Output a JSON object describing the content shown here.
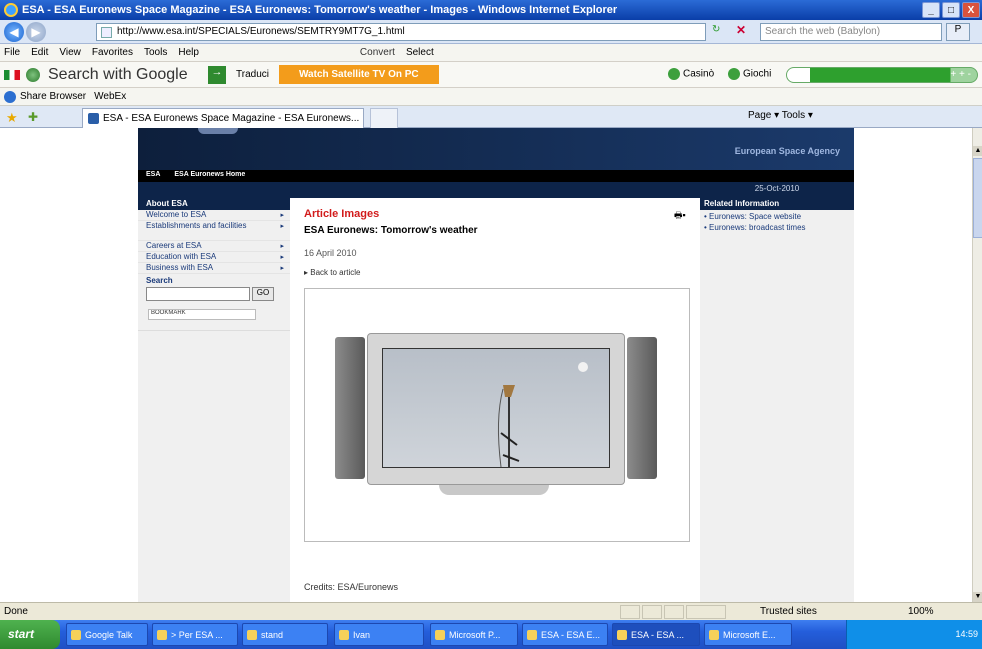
{
  "window": {
    "title": "ESA - ESA Euronews Space Magazine - ESA Euronews: Tomorrow's weather - Images - Windows Internet Explorer",
    "buttons": [
      "_",
      "□",
      "X"
    ]
  },
  "address_bar": {
    "url": "http://www.esa.int/SPECIALS/Euronews/SEMTRY9MT7G_1.html",
    "search_placeholder": "Search the web (Babylon)",
    "search_btn": "P"
  },
  "menu": {
    "items": [
      "File",
      "Edit",
      "View",
      "Favorites",
      "Tools",
      "Help"
    ],
    "convert": "Convert",
    "select": "Select"
  },
  "google_toolbar": {
    "search_placeholder": "Search with Google",
    "go": "→",
    "traduci": "Traduci",
    "watch": "Watch Satellite TV On PC",
    "casino": "Casinò",
    "giochi": "Giochi",
    "volume_label": "+ + -"
  },
  "links_bar": {
    "items": [
      "Share Browser",
      "WebEx"
    ]
  },
  "tabs": {
    "active_tab": "ESA - ESA Euronews Space Magazine - ESA Euronews...",
    "command_bar": "Page ▾   Tools ▾"
  },
  "site": {
    "agency": "European Space Agency",
    "nav": [
      "ESA",
      "ESA Euronews Home"
    ],
    "date": "25-Oct-2010",
    "left": {
      "heading": "About ESA",
      "items": [
        "Welcome to ESA",
        "Establishments and facilities",
        "Careers at ESA",
        "Education with ESA",
        "Business with ESA"
      ],
      "search_label": "Search",
      "go": "GO",
      "bookmark": "BOOKMARK"
    },
    "article": {
      "section": "Article Images",
      "title": "ESA Euronews: Tomorrow's weather",
      "date": "16 April 2010",
      "back": "Back to article",
      "credits": "Credits: ESA/Euronews"
    },
    "right": {
      "heading": "Related Information",
      "links": [
        "Euronews: Space website",
        "Euronews: broadcast times"
      ]
    }
  },
  "statusbar": {
    "status": "Done",
    "zone": "Trusted sites",
    "zoom": "100%"
  },
  "taskbar": {
    "start": "start",
    "buttons": [
      "Google Talk",
      "> Per ESA ...",
      "stand",
      "Ivan",
      "Microsoft P...",
      "ESA - ESA E...",
      "ESA - ESA ...",
      "Microsoft E..."
    ],
    "clock": "14:59"
  }
}
